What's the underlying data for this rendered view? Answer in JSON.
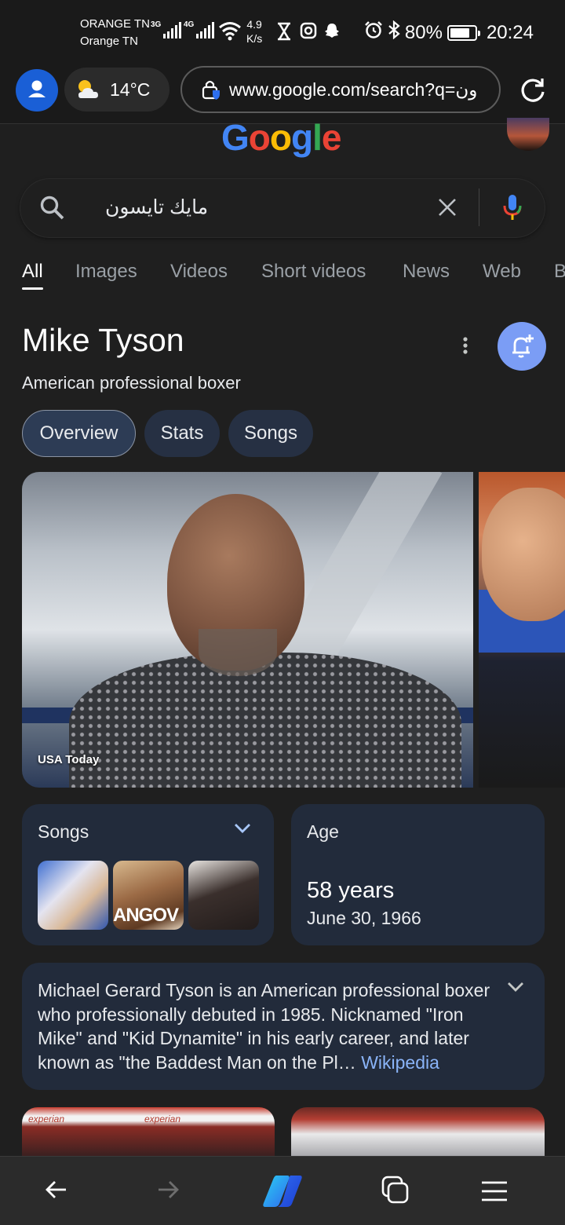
{
  "status_bar": {
    "carrier_1": "ORANGE TN",
    "carrier_2": "Orange TN",
    "net_1": "3G",
    "net_2": "4G",
    "speed_value": "4.9",
    "speed_unit": "K/s",
    "battery": "80%",
    "battery_level": 0.8,
    "time": "20:24"
  },
  "browser": {
    "weather": "14°C",
    "url": "www.google.com/search?q=ون"
  },
  "search": {
    "query": "مايك تايسون",
    "tabs": [
      "All",
      "Images",
      "Videos",
      "Short videos",
      "News",
      "Web",
      "B"
    ],
    "active_tab": "All"
  },
  "entity": {
    "name": "Mike Tyson",
    "description": "American professional boxer",
    "chips": [
      "Overview",
      "Stats",
      "Songs"
    ],
    "active_chip": "Overview",
    "image_credit": "USA Today"
  },
  "songs_card": {
    "label": "Songs",
    "thumb_text": "ANGOV"
  },
  "age_card": {
    "label": "Age",
    "value": "58 years",
    "date": "June 30, 1966"
  },
  "about": {
    "text": "Michael Gerard Tyson is an American professional boxer who professionally debuted in 1985. Nicknamed \"Iron Mike\" and \"Kid Dynamite\" in his early career, and later known as \"the Baddest Man on the Pl…",
    "source_link": "Wikipedia"
  },
  "news_strip": {
    "sponsor_text": "experian"
  },
  "colors": {
    "background": "#1f1f1f",
    "card": "#222b3b",
    "link": "#8ab4f8",
    "follow_button": "#7b9df5",
    "google_blue": "#4285f4",
    "google_red": "#ea4335",
    "google_yellow": "#fbbc05",
    "google_green": "#34a853"
  },
  "icons": {
    "profile": "person-icon",
    "weather": "partly-cloudy-icon",
    "lock": "lock-shield-icon",
    "reload": "reload-icon",
    "search": "search-icon",
    "clear": "close-icon",
    "mic": "mic-icon",
    "more": "more-vert-icon",
    "follow": "bell-add-icon",
    "back": "arrow-left-icon",
    "forward": "arrow-right-icon",
    "copilot": "copilot-icon",
    "tabs": "tabs-icon",
    "menu": "hamburger-menu-icon"
  }
}
